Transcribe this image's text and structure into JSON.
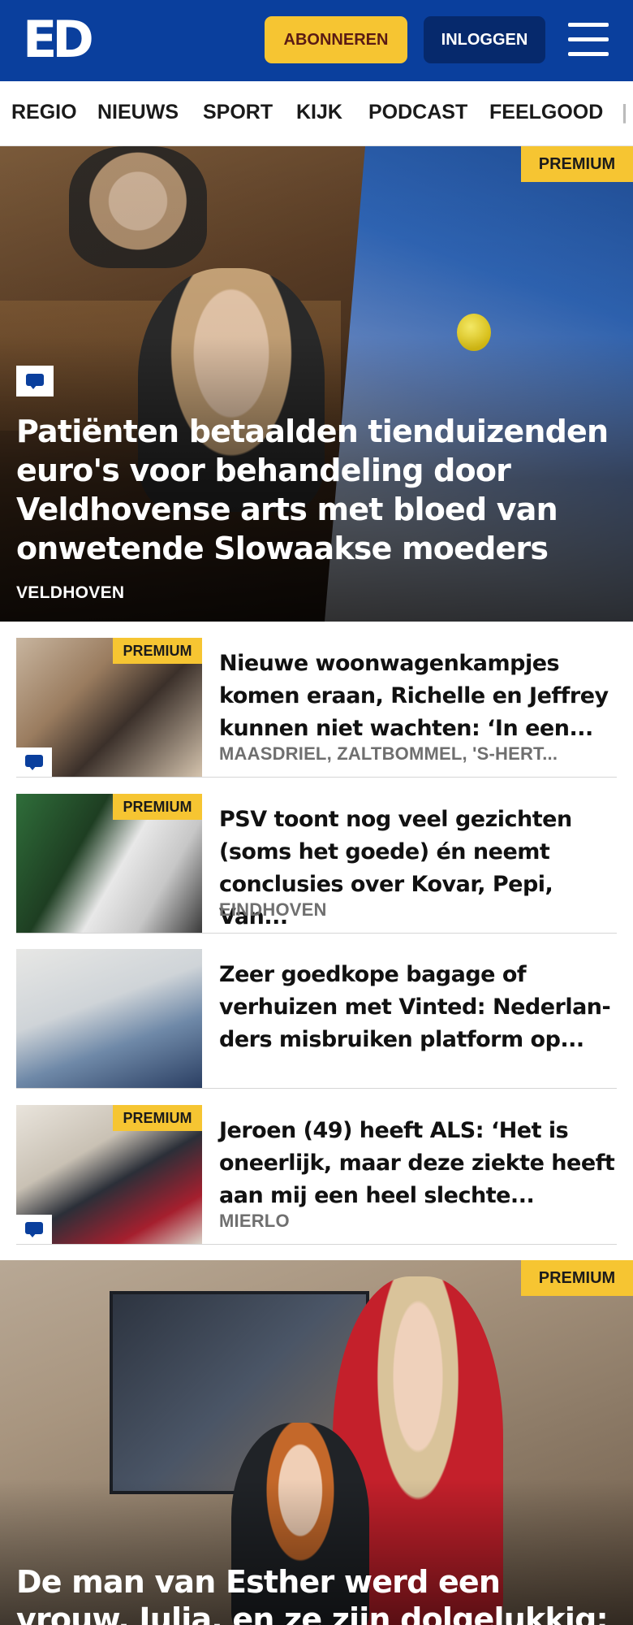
{
  "header": {
    "logo": "ED",
    "subscribe_label": "ABONNEREN",
    "login_label": "INLOGGEN",
    "menu_icon": "hamburger-menu-icon",
    "background_color": "#0a3f9d",
    "accent_color": "#f6c532"
  },
  "nav": {
    "items": [
      "REGIO",
      "NIEUWS",
      "SPORT",
      "KIJK",
      "PODCAST",
      "FEELGOOD"
    ]
  },
  "hero": {
    "badge": "PREMIUM",
    "title": "Patiënten betaalden tienduizenden euro's voor behandeling door Veldhovense arts met bloed van onwetende Slowaakse moeders",
    "location": "VELDHOVEN",
    "has_comments_icon": true
  },
  "articles": [
    {
      "badge": "PREMIUM",
      "title": "Nieuwe woonwagenkampjes komen eraan, Richelle en Jeffrey kunnen niet wachten: ‘In een...",
      "location": "MAASDRIEL, ZALTBOMMEL, 'S-HERT...",
      "has_comments_icon": true
    },
    {
      "badge": "PREMIUM",
      "title": "PSV toont nog veel gezichten (soms het goede) én neemt conclusies over Kovar, Pepi, Van...",
      "location": "EINDHOVEN",
      "has_comments_icon": false
    },
    {
      "badge": "",
      "title": "Zeer goedkope bagage of verhuizen met Vinted: Nederlan-ders misbruiken platform op...",
      "location": "",
      "has_comments_icon": false
    },
    {
      "badge": "PREMIUM",
      "title": "Jeroen (49) heeft ALS: ‘Het is oneerlijk, maar deze ziekte heeft aan mij een heel slechte...",
      "location": "MIERLO",
      "has_comments_icon": true
    }
  ],
  "feature": {
    "badge": "PREMIUM",
    "title": "De man van Esther werd een vrouw, Julia, en ze zijn dolgelukkig: ‘We..."
  }
}
